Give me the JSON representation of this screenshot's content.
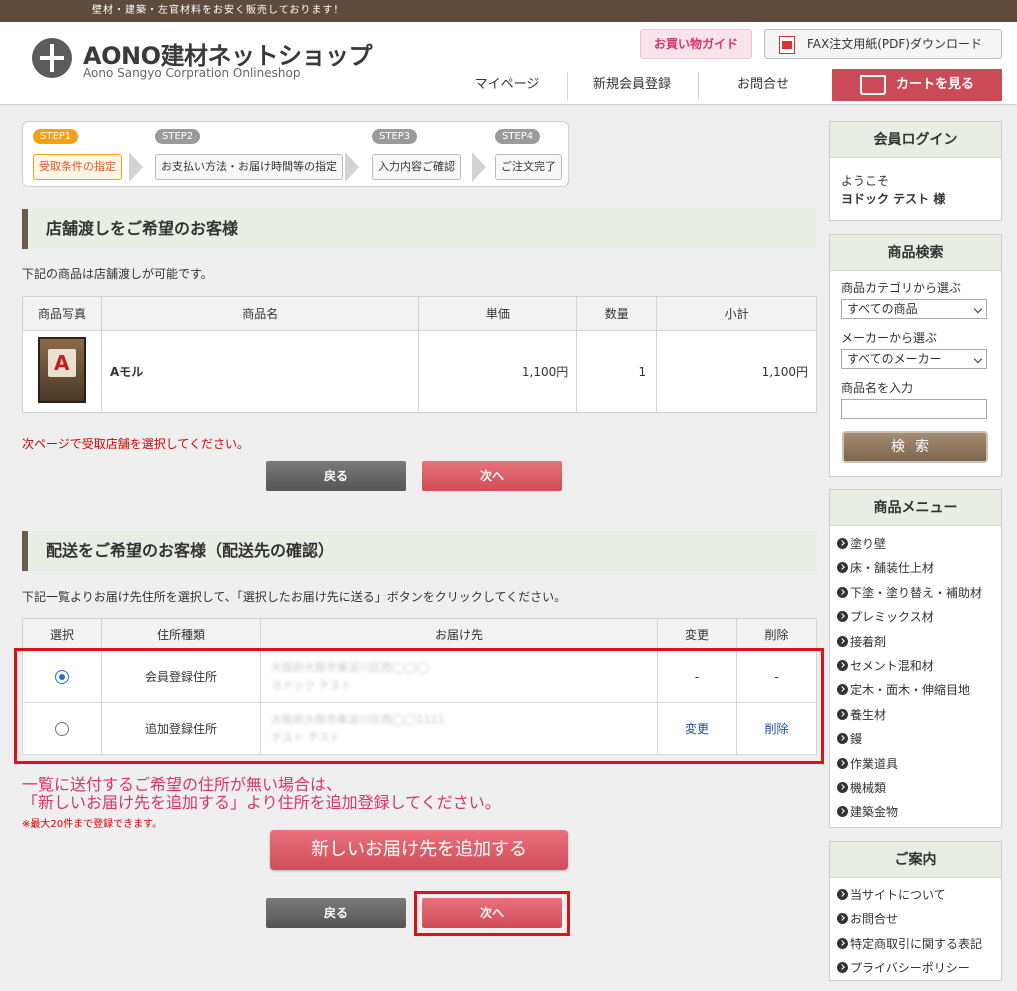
{
  "top_bar": {
    "tagline": "壁材・建築・左官材料をお安く販売しております！"
  },
  "header": {
    "logo_title": "AONO建材ネットショップ",
    "logo_sub": "Aono Sangyo  Corpration  Onlineshop",
    "guide_label": "お買い物ガイド",
    "fax_label": "FAX注文用紙(PDF)ダウンロード",
    "nav": [
      "マイページ",
      "新規会員登録",
      "お問合せ"
    ],
    "cart_label": "カートを見る"
  },
  "steps": [
    {
      "tag": "STEP1",
      "label": "受取条件の指定",
      "active": true
    },
    {
      "tag": "STEP2",
      "label": "お支払い方法・お届け時間等の指定",
      "active": false
    },
    {
      "tag": "STEP3",
      "label": "入力内容ご確認",
      "active": false
    },
    {
      "tag": "STEP4",
      "label": "ご注文完了",
      "active": false
    }
  ],
  "store_pickup": {
    "heading": "店舗渡しをご希望のお客様",
    "note": "下記の商品は店舗渡しが可能です。",
    "columns": [
      "商品写真",
      "商品名",
      "単価",
      "数量",
      "小計"
    ],
    "row": {
      "name": "Aモル",
      "price": "1,100円",
      "qty": "1",
      "subtotal": "1,100円"
    },
    "warning": "次ページで受取店舗を選択してください。",
    "back_label": "戻る",
    "next_label": "次へ"
  },
  "delivery": {
    "heading": "配送をご希望のお客様（配送先の確認）",
    "note": "下記一覧よりお届け先住所を選択して、「選択したお届け先に送る」ボタンをクリックしてください。",
    "columns": [
      "選択",
      "住所種類",
      "お届け先",
      "変更",
      "削除"
    ],
    "rows": [
      {
        "type": "会員登録住所",
        "addr1": "大阪府大阪市東淀川区西◯◯◯",
        "addr2": "ヨドック テスト",
        "change": "-",
        "delete": "-",
        "selected": true
      },
      {
        "type": "追加登録住所",
        "addr1": "大阪府大阪市東淀川区西◯◯1111",
        "addr2": "テスト テスト",
        "change": "変更",
        "delete": "削除",
        "selected": false
      }
    ],
    "msg_line1": "一覧に送付するご希望の住所が無い場合は、",
    "msg_line2": "「新しいお届け先を追加する」より住所を追加登録してください。",
    "msg_small": "※最大20件まで登録できます。",
    "add_label": "新しいお届け先を追加する",
    "back_label": "戻る",
    "next_label": "次へ"
  },
  "sidebar": {
    "login": {
      "title": "会員ログイン",
      "welcome": "ようこそ",
      "user": "ヨドック テスト 様"
    },
    "search": {
      "title": "商品検索",
      "category_label": "商品カテゴリから選ぶ",
      "category_value": "すべての商品",
      "maker_label": "メーカーから選ぶ",
      "maker_value": "すべてのメーカー",
      "name_label": "商品名を入力",
      "button": "検索"
    },
    "menu": {
      "title": "商品メニュー",
      "items": [
        "塗り壁",
        "床・舗装仕上材",
        "下塗・塗り替え・補助材",
        "プレミックス材",
        "接着剤",
        "セメント混和材",
        "定木・面木・伸縮目地",
        "養生材",
        "鏝",
        "作業道具",
        "機械類",
        "建築金物"
      ]
    },
    "info": {
      "title": "ご案内",
      "items": [
        "当サイトについて",
        "お問合せ",
        "特定商取引に関する表記",
        "プライバシーポリシー"
      ]
    }
  }
}
